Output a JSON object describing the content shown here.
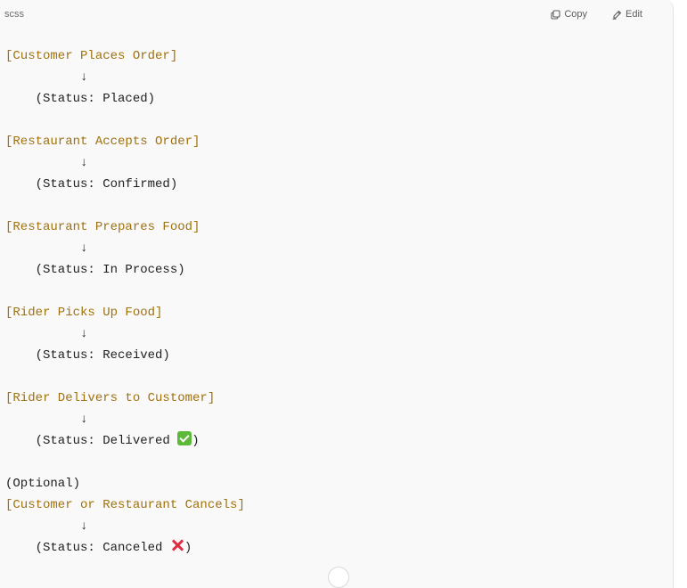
{
  "code_block": {
    "language": "scss",
    "copy_label": "Copy",
    "edit_label": "Edit",
    "lines": [
      {
        "kind": "bracket",
        "text": "[Customer Places Order]"
      },
      {
        "kind": "arrow",
        "text": "          ↓"
      },
      {
        "kind": "status",
        "text": "    (Status: Placed)"
      },
      {
        "kind": "blank",
        "text": ""
      },
      {
        "kind": "bracket",
        "text": "[Restaurant Accepts Order]"
      },
      {
        "kind": "arrow",
        "text": "          ↓"
      },
      {
        "kind": "status",
        "text": "    (Status: Confirmed)"
      },
      {
        "kind": "blank",
        "text": ""
      },
      {
        "kind": "bracket",
        "text": "[Restaurant Prepares Food]"
      },
      {
        "kind": "arrow",
        "text": "          ↓"
      },
      {
        "kind": "status",
        "text": "    (Status: In Process)"
      },
      {
        "kind": "blank",
        "text": ""
      },
      {
        "kind": "bracket",
        "text": "[Rider Picks Up Food]"
      },
      {
        "kind": "arrow",
        "text": "          ↓"
      },
      {
        "kind": "status",
        "text": "    (Status: Received)"
      },
      {
        "kind": "blank",
        "text": ""
      },
      {
        "kind": "bracket",
        "text": "[Rider Delivers to Customer]"
      },
      {
        "kind": "arrow",
        "text": "          ↓"
      },
      {
        "kind": "status",
        "text": "    (Status: Delivered ",
        "emoji": "check-mark-emoji",
        "suffix": ")"
      },
      {
        "kind": "blank",
        "text": ""
      },
      {
        "kind": "plain",
        "text": "(Optional)"
      },
      {
        "kind": "bracket",
        "text": "[Customer or Restaurant Cancels]"
      },
      {
        "kind": "arrow",
        "text": "          ↓"
      },
      {
        "kind": "status",
        "text": "    (Status: Canceled ",
        "emoji": "cross-mark-emoji",
        "suffix": ")"
      }
    ]
  },
  "colors": {
    "bracket_text": "#a0710c",
    "plain_text": "#1f1f1f",
    "card_background": "#f9f9f9"
  },
  "icons": {
    "copy": "copy-icon",
    "edit": "edit-icon",
    "scroll": "scroll-down-button"
  }
}
